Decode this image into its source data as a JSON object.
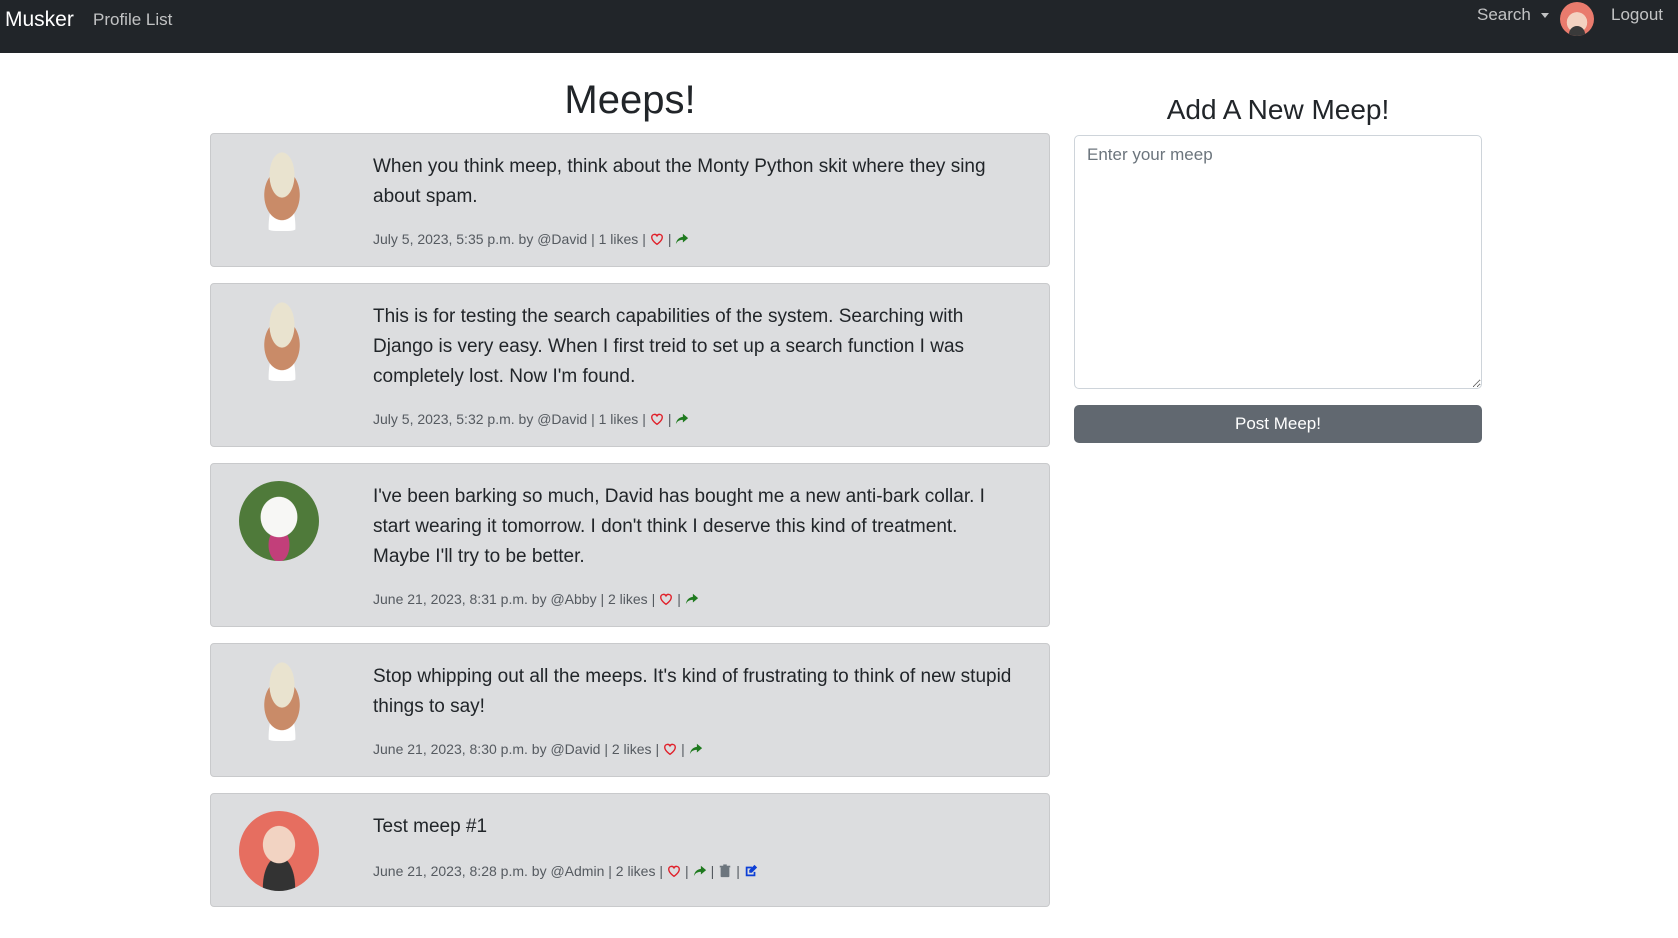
{
  "navbar": {
    "brand": "Musker",
    "profile_list": "Profile List",
    "search": "Search",
    "logout": "Logout"
  },
  "main": {
    "title": "Meeps!",
    "meeps": [
      {
        "text": "When you think meep, think about the Monty Python skit where they sing about spam.",
        "meta": "July 5, 2023, 5:35 p.m. by @David | 1 likes |"
      },
      {
        "text": "This is for testing the search capabilities of the system. Searching with Django is very easy. When I first treid to set up a search function I was completely lost. Now I'm found.",
        "meta": "July 5, 2023, 5:32 p.m. by @David | 1 likes |"
      },
      {
        "text": "I've been barking so much, David has bought me a new anti-bark collar. I start wearing it tomorrow. I don't think I deserve this kind of treatment. Maybe I'll try to be better.",
        "meta": "June 21, 2023, 8:31 p.m. by @Abby | 2 likes |"
      },
      {
        "text": "Stop whipping out all the meeps. It's kind of frustrating to think of new stupid things to say!",
        "meta": "June 21, 2023, 8:30 p.m. by @David | 2 likes |"
      },
      {
        "text": "Test meep #1",
        "meta": "June 21, 2023, 8:28 p.m. by @Admin | 2 likes |"
      }
    ]
  },
  "sidebar": {
    "title": "Add A New Meep!",
    "input_placeholder": "Enter your meep",
    "post_button": "Post Meep!"
  },
  "separator": "|",
  "colors": {
    "navbar_bg": "#212529",
    "card_bg": "#dcdddf",
    "heart": "#e0202a",
    "share": "#1f7a1f",
    "trash": "#6c757d",
    "edit": "#0d3fd6",
    "button_bg": "#616870"
  },
  "icons": [
    "heart-icon",
    "share-icon",
    "trash-icon",
    "edit-icon",
    "caret-down-icon"
  ]
}
